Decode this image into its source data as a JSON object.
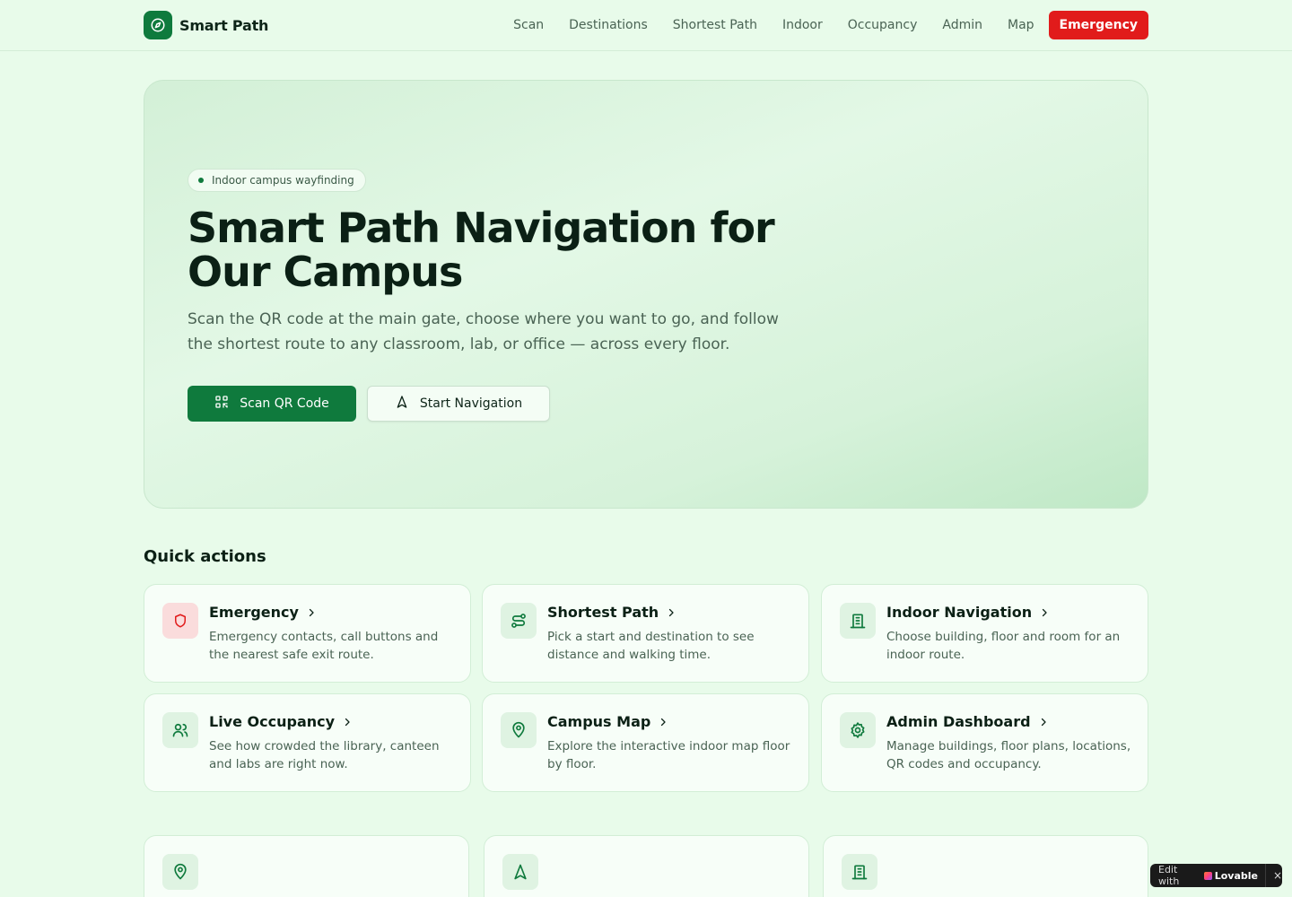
{
  "header": {
    "brand": "Smart Path",
    "nav": [
      "Scan",
      "Destinations",
      "Shortest Path",
      "Indoor",
      "Occupancy",
      "Admin",
      "Map"
    ],
    "emergency": "Emergency"
  },
  "hero": {
    "badge": "Indoor campus wayfinding",
    "title": "Smart Path Navigation for Our Campus",
    "subtitle": "Scan the QR code at the main gate, choose where you want to go, and follow the shortest route to any classroom, lab, or office — across every floor.",
    "primary_button": "Scan QR Code",
    "secondary_button": "Start Navigation"
  },
  "quick_actions": {
    "title": "Quick actions",
    "cards": [
      {
        "icon": "shield-icon",
        "title": "Emergency",
        "desc": "Emergency contacts, call buttons and the nearest safe exit route."
      },
      {
        "icon": "route-icon",
        "title": "Shortest Path",
        "desc": "Pick a start and destination to see distance and walking time."
      },
      {
        "icon": "building-icon",
        "title": "Indoor Navigation",
        "desc": "Choose building, floor and room for an indoor route."
      },
      {
        "icon": "users-icon",
        "title": "Live Occupancy",
        "desc": "See how crowded the library, canteen and labs are right now."
      },
      {
        "icon": "map-pin-icon",
        "title": "Campus Map",
        "desc": "Explore the interactive indoor map floor by floor."
      },
      {
        "icon": "gear-icon",
        "title": "Admin Dashboard",
        "desc": "Manage buildings, floor plans, locations, QR codes and occupancy."
      }
    ]
  },
  "lower_cards": [
    {
      "icon": "map-pin-icon"
    },
    {
      "icon": "navigation-icon"
    },
    {
      "icon": "building-icon"
    }
  ],
  "lovable": {
    "edit": "Edit with",
    "brand": "Lovable",
    "close": "×"
  },
  "colors": {
    "accent": "#0f7a3d",
    "emergency": "#e11b1b",
    "background": "#e8fbea"
  }
}
